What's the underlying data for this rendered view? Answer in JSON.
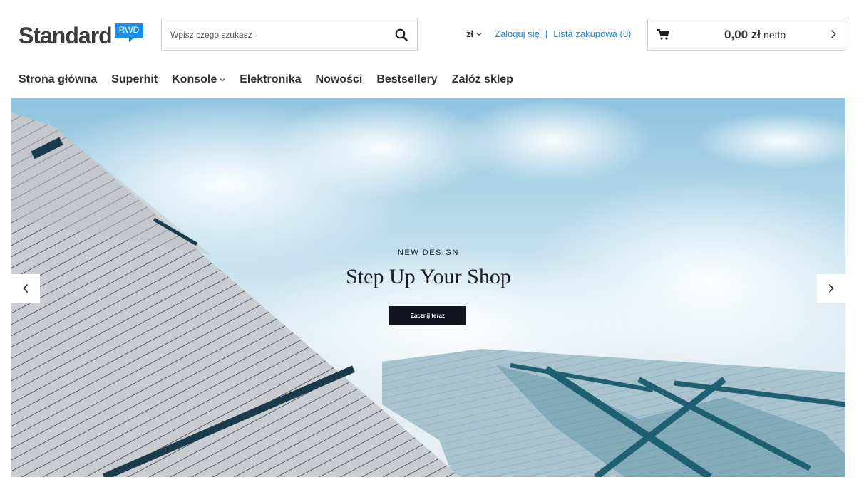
{
  "header": {
    "logo_text": "Standard",
    "logo_badge": "RWD",
    "search_placeholder": "Wpisz czego szukasz",
    "currency": "zł",
    "login": "Zaloguj się",
    "separator": "|",
    "shopping_list": "Lista zakupowa (0)",
    "cart_amount": "0,00 zł",
    "cart_net": "netto"
  },
  "nav": {
    "items": [
      {
        "label": "Strona główna"
      },
      {
        "label": "Superhit"
      },
      {
        "label": "Konsole"
      },
      {
        "label": "Elektronika"
      },
      {
        "label": "Nowości"
      },
      {
        "label": "Bestsellery"
      },
      {
        "label": "Załóż sklep"
      }
    ]
  },
  "hero": {
    "eyebrow": "NEW DESIGN",
    "headline": "Step Up Your Shop",
    "cta": "Zacznij teraz"
  },
  "icons": {
    "search": "search-icon",
    "cart": "cart-icon",
    "chevron_right": "chevron-right-icon",
    "chevron_left": "chevron-left-icon",
    "chevron_down": "chevron-down-icon"
  },
  "colors": {
    "accent": "#1a8ee8",
    "text": "#333333",
    "cta_bg": "#12141f"
  }
}
